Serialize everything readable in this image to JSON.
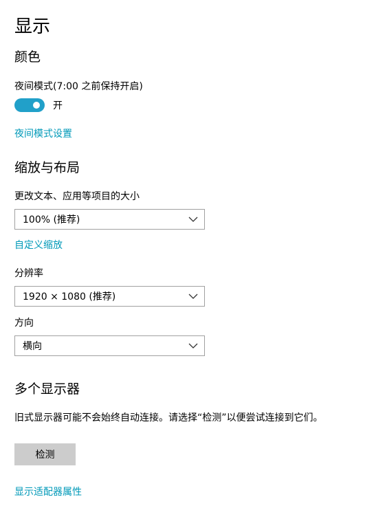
{
  "page": {
    "title": "显示"
  },
  "color": {
    "heading": "颜色",
    "night_mode_label": "夜间模式(7:00 之前保持开启)",
    "night_mode_toggle": {
      "state": "on",
      "state_label": "开",
      "accent": "#21a0c9"
    },
    "night_mode_settings_link": "夜间模式设置"
  },
  "scale_layout": {
    "heading": "缩放与布局",
    "size_label": "更改文本、应用等项目的大小",
    "size_value": "100% (推荐)",
    "custom_scaling_link": "自定义缩放",
    "resolution_label": "分辨率",
    "resolution_value": "1920 × 1080 (推荐)",
    "orientation_label": "方向",
    "orientation_value": "横向"
  },
  "multiple_displays": {
    "heading": "多个显示器",
    "description": "旧式显示器可能不会始终自动连接。请选择“检测”以便尝试连接到它们。",
    "detect_button": "检测",
    "adapter_properties_link": "显示适配器属性"
  },
  "colors": {
    "link": "#0099b8",
    "button_bg": "#cccccc",
    "select_border": "#a0a0a0"
  }
}
